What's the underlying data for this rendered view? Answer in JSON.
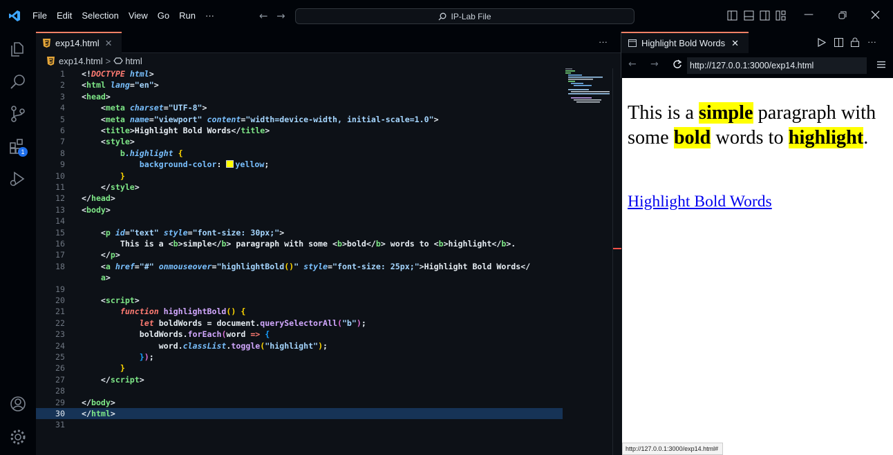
{
  "menu": [
    "File",
    "Edit",
    "Selection",
    "View",
    "Go",
    "Run",
    "···"
  ],
  "command_center": "IP-Lab File",
  "editor": {
    "tab_label": "exp14.html",
    "breadcrumb": {
      "file": "exp14.html",
      "separator": ">",
      "node": "html"
    },
    "current_line": 30,
    "lines": [
      {
        "n": "1",
        "segs": [
          {
            "c": "pu",
            "t": "<!"
          },
          {
            "c": "kw",
            "t": "DOCTYPE "
          },
          {
            "c": "at",
            "t": "html"
          },
          {
            "c": "pu",
            "t": ">"
          }
        ]
      },
      {
        "n": "2",
        "segs": [
          {
            "c": "pu",
            "t": "<"
          },
          {
            "c": "tg",
            "t": "html "
          },
          {
            "c": "at",
            "t": "lang"
          },
          {
            "c": "pu",
            "t": "="
          },
          {
            "c": "st",
            "t": "\"en\""
          },
          {
            "c": "pu",
            "t": ">"
          }
        ]
      },
      {
        "n": "3",
        "segs": [
          {
            "c": "pu",
            "t": "<"
          },
          {
            "c": "tg",
            "t": "head"
          },
          {
            "c": "pu",
            "t": ">"
          }
        ]
      },
      {
        "n": "4",
        "segs": [
          {
            "c": "pu",
            "t": "    <"
          },
          {
            "c": "tg",
            "t": "meta "
          },
          {
            "c": "at",
            "t": "charset"
          },
          {
            "c": "pu",
            "t": "="
          },
          {
            "c": "st",
            "t": "\"UTF-8\""
          },
          {
            "c": "pu",
            "t": ">"
          }
        ]
      },
      {
        "n": "5",
        "segs": [
          {
            "c": "pu",
            "t": "    <"
          },
          {
            "c": "tg",
            "t": "meta "
          },
          {
            "c": "at",
            "t": "name"
          },
          {
            "c": "pu",
            "t": "="
          },
          {
            "c": "st",
            "t": "\"viewport\" "
          },
          {
            "c": "at",
            "t": "content"
          },
          {
            "c": "pu",
            "t": "="
          },
          {
            "c": "st",
            "t": "\"width=device-width, initial-scale=1.0\""
          },
          {
            "c": "pu",
            "t": ">"
          }
        ]
      },
      {
        "n": "6",
        "segs": [
          {
            "c": "pu",
            "t": "    <"
          },
          {
            "c": "tg",
            "t": "title"
          },
          {
            "c": "pu",
            "t": ">Highlight Bold Words</"
          },
          {
            "c": "tg",
            "t": "title"
          },
          {
            "c": "pu",
            "t": ">"
          }
        ]
      },
      {
        "n": "7",
        "segs": [
          {
            "c": "pu",
            "t": "    <"
          },
          {
            "c": "tg",
            "t": "style"
          },
          {
            "c": "pu",
            "t": ">"
          }
        ]
      },
      {
        "n": "8",
        "segs": [
          {
            "c": "pu",
            "t": "        "
          },
          {
            "c": "tg",
            "t": "b"
          },
          {
            "c": "at",
            "t": ".highlight "
          },
          {
            "c": "br1",
            "t": "{"
          }
        ]
      },
      {
        "n": "9",
        "segs": [
          {
            "c": "pu",
            "t": "            "
          },
          {
            "c": "pr",
            "t": "background-color"
          },
          {
            "c": "pu",
            "t": ": "
          },
          {
            "c": "sw",
            "t": ""
          },
          {
            "c": "pr",
            "t": "yellow"
          },
          {
            "c": "pu",
            "t": ";"
          }
        ]
      },
      {
        "n": "10",
        "segs": [
          {
            "c": "pu",
            "t": "        "
          },
          {
            "c": "br1",
            "t": "}"
          }
        ]
      },
      {
        "n": "11",
        "segs": [
          {
            "c": "pu",
            "t": "    </"
          },
          {
            "c": "tg",
            "t": "style"
          },
          {
            "c": "pu",
            "t": ">"
          }
        ]
      },
      {
        "n": "12",
        "segs": [
          {
            "c": "pu",
            "t": "</"
          },
          {
            "c": "tg",
            "t": "head"
          },
          {
            "c": "pu",
            "t": ">"
          }
        ]
      },
      {
        "n": "13",
        "segs": [
          {
            "c": "pu",
            "t": "<"
          },
          {
            "c": "tg",
            "t": "body"
          },
          {
            "c": "pu",
            "t": ">"
          }
        ]
      },
      {
        "n": "14",
        "segs": []
      },
      {
        "n": "15",
        "segs": [
          {
            "c": "pu",
            "t": "    <"
          },
          {
            "c": "tg",
            "t": "p "
          },
          {
            "c": "at",
            "t": "id"
          },
          {
            "c": "pu",
            "t": "="
          },
          {
            "c": "st",
            "t": "\"text\" "
          },
          {
            "c": "at",
            "t": "style"
          },
          {
            "c": "pu",
            "t": "="
          },
          {
            "c": "st",
            "t": "\"font-size: 30px;\""
          },
          {
            "c": "pu",
            "t": ">"
          }
        ]
      },
      {
        "n": "16",
        "segs": [
          {
            "c": "pu",
            "t": "        This is a <"
          },
          {
            "c": "tg",
            "t": "b"
          },
          {
            "c": "pu",
            "t": ">simple</"
          },
          {
            "c": "tg",
            "t": "b"
          },
          {
            "c": "pu",
            "t": "> paragraph with some <"
          },
          {
            "c": "tg",
            "t": "b"
          },
          {
            "c": "pu",
            "t": ">bold</"
          },
          {
            "c": "tg",
            "t": "b"
          },
          {
            "c": "pu",
            "t": "> words to <"
          },
          {
            "c": "tg",
            "t": "b"
          },
          {
            "c": "pu",
            "t": ">highlight</"
          },
          {
            "c": "tg",
            "t": "b"
          },
          {
            "c": "pu",
            "t": ">."
          }
        ]
      },
      {
        "n": "17",
        "segs": [
          {
            "c": "pu",
            "t": "    </"
          },
          {
            "c": "tg",
            "t": "p"
          },
          {
            "c": "pu",
            "t": ">"
          }
        ]
      },
      {
        "n": "18",
        "segs": [
          {
            "c": "pu",
            "t": "    <"
          },
          {
            "c": "tg",
            "t": "a "
          },
          {
            "c": "at",
            "t": "href"
          },
          {
            "c": "pu",
            "t": "="
          },
          {
            "c": "st",
            "t": "\"#\" "
          },
          {
            "c": "at",
            "t": "onmouseover"
          },
          {
            "c": "pu",
            "t": "="
          },
          {
            "c": "st",
            "t": "\"highlightBold"
          },
          {
            "c": "br1",
            "t": "()"
          },
          {
            "c": "st",
            "t": "\" "
          },
          {
            "c": "at",
            "t": "style"
          },
          {
            "c": "pu",
            "t": "="
          },
          {
            "c": "st",
            "t": "\"font-size: 25px;\""
          },
          {
            "c": "pu",
            "t": ">Highlight Bold Words</"
          }
        ]
      },
      {
        "n": "",
        "segs": [
          {
            "c": "pu",
            "t": "    "
          },
          {
            "c": "tg",
            "t": "a"
          },
          {
            "c": "pu",
            "t": ">"
          }
        ]
      },
      {
        "n": "19",
        "segs": []
      },
      {
        "n": "20",
        "segs": [
          {
            "c": "pu",
            "t": "    <"
          },
          {
            "c": "tg",
            "t": "script"
          },
          {
            "c": "pu",
            "t": ">"
          }
        ]
      },
      {
        "n": "21",
        "segs": [
          {
            "c": "pu",
            "t": "        "
          },
          {
            "c": "kw",
            "t": "function "
          },
          {
            "c": "fn",
            "t": "highlightBold"
          },
          {
            "c": "br1",
            "t": "() {"
          }
        ]
      },
      {
        "n": "22",
        "segs": [
          {
            "c": "pu",
            "t": "            "
          },
          {
            "c": "kw",
            "t": "let "
          },
          {
            "c": "pu",
            "t": "boldWords = document."
          },
          {
            "c": "fn",
            "t": "querySelectorAll"
          },
          {
            "c": "br2",
            "t": "("
          },
          {
            "c": "st",
            "t": "\"b\""
          },
          {
            "c": "br2",
            "t": ")"
          },
          {
            "c": "pu",
            "t": ";"
          }
        ]
      },
      {
        "n": "23",
        "segs": [
          {
            "c": "pu",
            "t": "            boldWords."
          },
          {
            "c": "fn",
            "t": "forEach"
          },
          {
            "c": "br2",
            "t": "("
          },
          {
            "c": "pu",
            "t": "word "
          },
          {
            "c": "kw",
            "t": "=> "
          },
          {
            "c": "br3",
            "t": "{"
          }
        ]
      },
      {
        "n": "24",
        "segs": [
          {
            "c": "pu",
            "t": "                word."
          },
          {
            "c": "at",
            "t": "classList"
          },
          {
            "c": "pu",
            "t": "."
          },
          {
            "c": "fn",
            "t": "toggle"
          },
          {
            "c": "br1",
            "t": "("
          },
          {
            "c": "st",
            "t": "\"highlight\""
          },
          {
            "c": "br1",
            "t": ")"
          },
          {
            "c": "pu",
            "t": ";"
          }
        ]
      },
      {
        "n": "25",
        "segs": [
          {
            "c": "pu",
            "t": "            "
          },
          {
            "c": "br3",
            "t": "}"
          },
          {
            "c": "br2",
            "t": ")"
          },
          {
            "c": "pu",
            "t": ";"
          }
        ]
      },
      {
        "n": "26",
        "segs": [
          {
            "c": "pu",
            "t": "        "
          },
          {
            "c": "br1",
            "t": "}"
          }
        ]
      },
      {
        "n": "27",
        "segs": [
          {
            "c": "pu",
            "t": "    </"
          },
          {
            "c": "tg",
            "t": "script"
          },
          {
            "c": "pu",
            "t": ">"
          }
        ]
      },
      {
        "n": "28",
        "segs": []
      },
      {
        "n": "29",
        "segs": [
          {
            "c": "pu",
            "t": "</"
          },
          {
            "c": "tg",
            "t": "body"
          },
          {
            "c": "pu",
            "t": ">"
          }
        ]
      },
      {
        "n": "30",
        "segs": [
          {
            "c": "pu",
            "t": "</"
          },
          {
            "c": "tg",
            "t": "html"
          },
          {
            "c": "pu",
            "t": ">"
          }
        ]
      },
      {
        "n": "31",
        "segs": []
      }
    ]
  },
  "browser": {
    "tab_label": "Highlight Bold Words",
    "url": "http://127.0.0.1:3000/exp14.html",
    "status_url": "http://127.0.0.1:3000/exp14.html#",
    "paragraph": {
      "p1": "This is a ",
      "b1": "simple",
      "p2": " paragraph with some ",
      "b2": "bold",
      "p3": " words to ",
      "b3": "highlight",
      "p4": "."
    },
    "link_text": "Highlight Bold Words"
  },
  "badges": {
    "extensions": "1"
  },
  "colors": {
    "highlight": "#ffff00",
    "link": "#0000ee",
    "accent_tab": "#f78166"
  }
}
